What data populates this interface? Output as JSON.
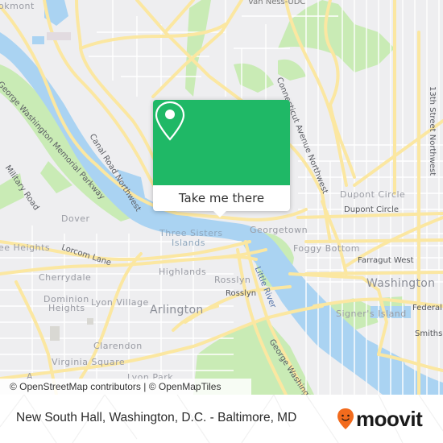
{
  "map": {
    "colors": {
      "land": "#eeeef0",
      "water": "#aad3f2",
      "park": "#c9ebb5",
      "major_road": "#fbe7a1",
      "minor_road": "#ffffff",
      "accent": "#1fb866",
      "brand_orange": "#f26b1d"
    },
    "labels": {
      "brookmont": "okmont",
      "van_ness": "Van Ness-UDC",
      "connecticut": "Connecticut Avenue Northwest",
      "thirteenth": "13th Street Northwest",
      "gw_parkway": "George Washington Memorial Parkway",
      "canal_road": "Canal Road Northwest",
      "military_road": "Military Road",
      "dover": "Dover",
      "lee_heights": "ee Heights",
      "lorcom": "Lorcom Lane",
      "cherrydale": "Cherrydale",
      "dominion_1": "Dominion",
      "dominion_2": "Heights",
      "lyon_village": "Lyon Village",
      "highlands": "Highlands",
      "arlington": "Arlington",
      "clarendon": "Clarendon",
      "virginia_square": "Virginia Square",
      "lyon_park": "Lyon Park",
      "three_sisters_1": "Three Sisters",
      "three_sisters_2": "Islands",
      "georgetown": "Georgetown",
      "dupont_area": "Dupont Circle",
      "dupont_station": "Dupont Circle",
      "foggy_bottom": "Foggy Bottom",
      "farragut": "Farragut West",
      "washington": "Washington",
      "rosslyn_area": "Rosslyn",
      "rosslyn_station": "Rosslyn",
      "little_river": "Little River",
      "signers_island": "Signer's Island",
      "federal_triangle": "Federal Tr",
      "smithsonian": "Smithson",
      "gw_parkway_south": "George Washington Me",
      "a_fragment": "A"
    },
    "attribution": "© OpenStreetMap contributors | © OpenMapTiles"
  },
  "popup": {
    "icon": "map-pin-icon",
    "button_label": "Take me there"
  },
  "footer": {
    "title": "New South Hall, Washington, D.C. - Baltimore, MD",
    "brand": "moovit",
    "brand_icon": "moovit-smiley-pin-icon"
  }
}
